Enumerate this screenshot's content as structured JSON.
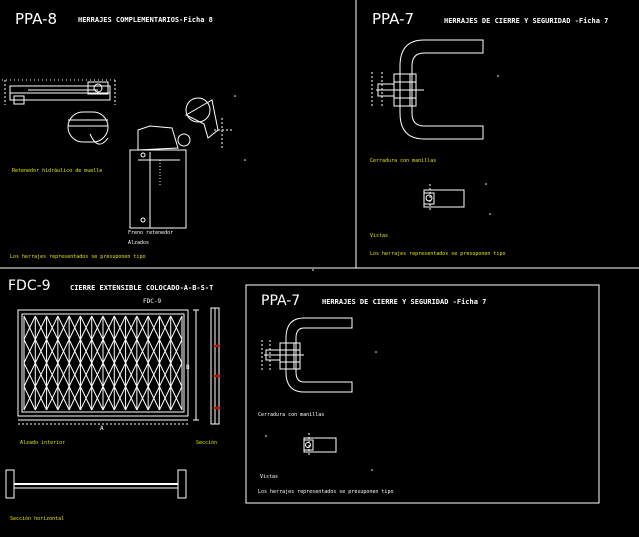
{
  "panels": {
    "ppa8": {
      "code": "PPA-8",
      "title": "HERRAJES COMPLEMENTARIOS-Ficha 8",
      "label_retenedor": "Retenedor hidráulico de muelle",
      "label_freno": "Freno retenedor",
      "label_alzados": "Alzados",
      "footnote": "Los herrajes representados se presuponen tipo"
    },
    "ppa7_top": {
      "code": "PPA-7",
      "title": "HERRAJES DE CIERRE Y SEGURIDAD -Ficha 7",
      "label_cerradura": "Cerradura con manillas",
      "label_vistas": "Vistas",
      "footnote": "Los herrajes representados se presuponen tipo"
    },
    "fdc9": {
      "code": "FDC-9",
      "title": "CIERRE EXTENSIBLE COLOCADO-A-B-S-T",
      "tag": "FDC-9",
      "dim_a": "A",
      "dim_b": "B",
      "label_alzado": "Alzado interior",
      "label_seccion": "Sección",
      "label_seccion_horizontal": "Sección horizontal"
    },
    "ppa7_bottom": {
      "code": "PPA-7",
      "title": "HERRAJES DE CIERRE Y SEGURIDAD -Ficha 7",
      "label_cerradura": "Cerradura con manillas",
      "label_vistas": "Vistas",
      "footnote": "Los herrajes representados se presuponen tipo"
    }
  }
}
